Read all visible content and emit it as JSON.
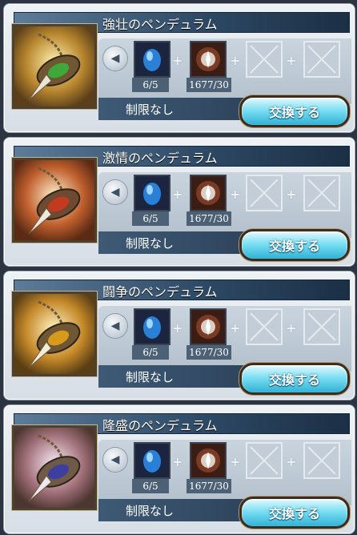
{
  "cards": [
    {
      "title": "強壮のペンデュラム",
      "materials": [
        {
          "icon": "blue-gem-icon",
          "qty": "6/5"
        },
        {
          "icon": "emblem-icon",
          "qty": "1677/30"
        }
      ],
      "limit": "制限なし",
      "button": "交換する",
      "accent": "#3fa83a"
    },
    {
      "title": "激情のペンデュラム",
      "materials": [
        {
          "icon": "blue-gem-icon",
          "qty": "6/5"
        },
        {
          "icon": "emblem-icon",
          "qty": "1677/30"
        }
      ],
      "limit": "制限なし",
      "button": "交換する",
      "accent": "#c43a1e"
    },
    {
      "title": "闘争のペンデュラム",
      "materials": [
        {
          "icon": "blue-gem-icon",
          "qty": "6/5"
        },
        {
          "icon": "emblem-icon",
          "qty": "1677/30"
        }
      ],
      "limit": "制限なし",
      "button": "交換する",
      "accent": "#d79a1c"
    },
    {
      "title": "隆盛のペンデュラム",
      "materials": [
        {
          "icon": "blue-gem-icon",
          "qty": "6/5"
        },
        {
          "icon": "emblem-icon",
          "qty": "1677/30"
        }
      ],
      "limit": "制限なし",
      "button": "交換する",
      "accent": "#3d3fa0"
    }
  ]
}
